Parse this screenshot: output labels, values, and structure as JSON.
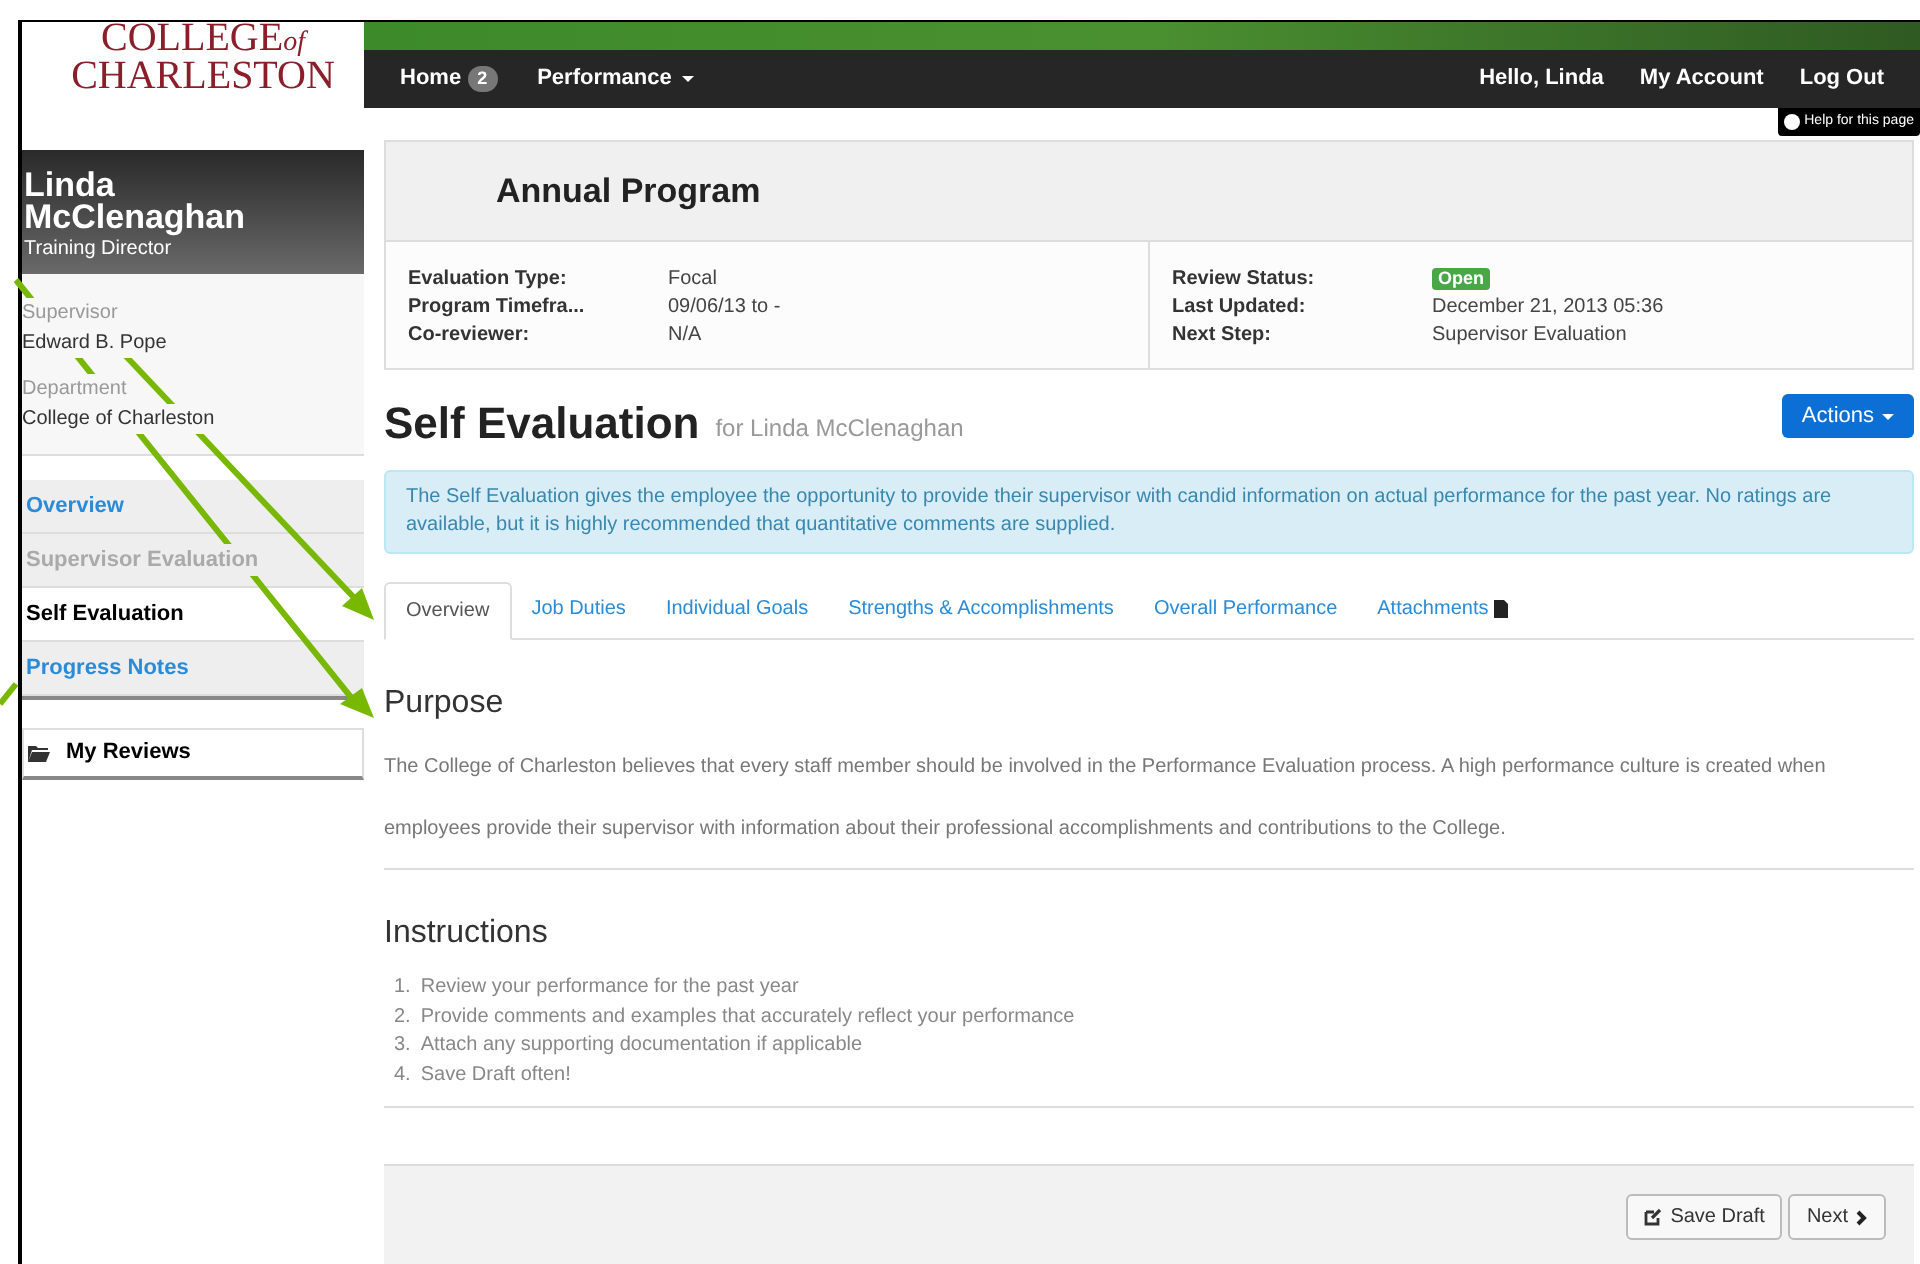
{
  "logo": {
    "line1": "COLLEGE",
    "of": "of",
    "line2": "CHARLESTON"
  },
  "navbar": {
    "items": [
      {
        "label": "Home",
        "badge": "2",
        "dropdown": false
      },
      {
        "label": "Performance",
        "dropdown": true
      }
    ],
    "right": [
      "Hello, Linda",
      "My Account",
      "Log Out"
    ]
  },
  "help": "Help for this page",
  "profile": {
    "name": "Linda McClenaghan",
    "title": "Training Director",
    "fields": [
      {
        "label": "Supervisor",
        "value": "Edward B. Pope"
      },
      {
        "label": "Department",
        "value": "College of Charleston"
      }
    ]
  },
  "sidebar": {
    "items": [
      {
        "label": "Overview",
        "selected": false,
        "disabled": false
      },
      {
        "label": "Supervisor Evaluation",
        "selected": false,
        "disabled": true
      },
      {
        "label": "Self Evaluation",
        "selected": true,
        "disabled": false
      },
      {
        "label": "Progress Notes",
        "selected": false,
        "disabled": false
      }
    ],
    "my_reviews": "My Reviews"
  },
  "program": {
    "title": "Annual Program",
    "left": [
      {
        "label": "Evaluation Type:",
        "value": "Focal"
      },
      {
        "label": "Program Timefra...",
        "value": "09/06/13 to -"
      },
      {
        "label": "Co-reviewer:",
        "value": "N/A"
      }
    ],
    "right": [
      {
        "label": "Review Status:",
        "value": "Open",
        "kind": "badge"
      },
      {
        "label": "Last Updated:",
        "value": "December 21, 2013 05:36",
        "kind": "text"
      },
      {
        "label": "Next Step:",
        "value": "Supervisor Evaluation",
        "kind": "text"
      }
    ]
  },
  "heading": {
    "title": "Self Evaluation",
    "subtitle": "for Linda McClenaghan",
    "actions": "Actions"
  },
  "alert": "The Self Evaluation gives the employee the opportunity to provide their supervisor with candid information on actual performance for the past year. No ratings are available, but it is highly recommended that quantitative comments are supplied.",
  "tabs": [
    {
      "label": "Overview",
      "selected": true,
      "icon": false
    },
    {
      "label": "Job Duties",
      "selected": false,
      "icon": false
    },
    {
      "label": "Individual Goals",
      "selected": false,
      "icon": false
    },
    {
      "label": "Strengths & Accomplishments",
      "selected": false,
      "icon": false
    },
    {
      "label": "Overall Performance",
      "selected": false,
      "icon": false
    },
    {
      "label": "Attachments",
      "selected": false,
      "icon": true
    }
  ],
  "purpose": {
    "title": "Purpose",
    "text": "The College of Charleston believes that every staff member should be involved in the Performance Evaluation process. A high performance culture is created when employees provide their supervisor with information about their professional accomplishments and contributions to the College."
  },
  "instructions": {
    "title": "Instructions",
    "items": [
      {
        "number": "1.",
        "text": "Review your performance for the past year"
      },
      {
        "number": "2.",
        "text": "Provide comments and examples that accurately reflect your performance"
      },
      {
        "number": "3.",
        "text": "Attach any supporting documentation if applicable"
      },
      {
        "number": "4.",
        "text": "Save Draft often!"
      }
    ]
  },
  "footer": {
    "save": "Save Draft",
    "next": "Next"
  }
}
